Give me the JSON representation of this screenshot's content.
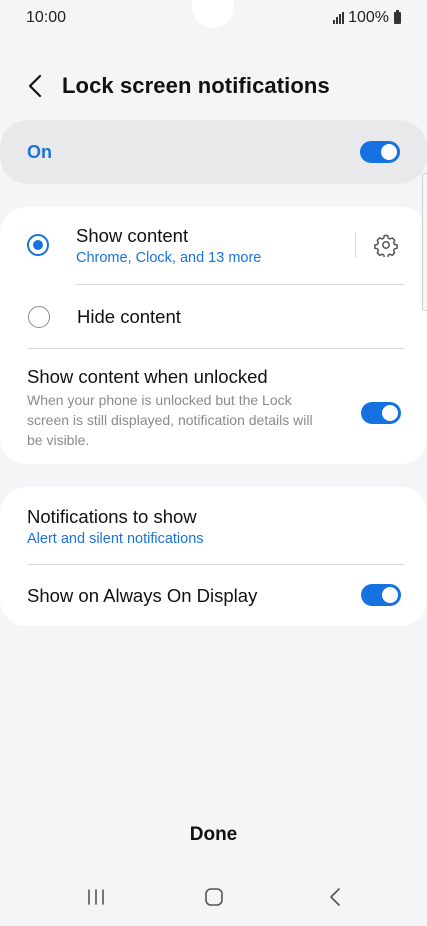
{
  "status_bar": {
    "time": "10:00",
    "battery": "100%"
  },
  "header": {
    "title": "Lock screen notifications"
  },
  "master_switch": {
    "label": "On",
    "enabled": true
  },
  "content_options": {
    "show_content": {
      "label": "Show content",
      "sublabel": "Chrome, Clock, and 13 more",
      "selected": true
    },
    "hide_content": {
      "label": "Hide content",
      "selected": false
    }
  },
  "show_when_unlocked": {
    "label": "Show content when unlocked",
    "description_lines": [
      "When your phone is unlocked but the Lock",
      "screen is still displayed, notification details will",
      "be visible."
    ],
    "enabled": true
  },
  "notifications_to_show": {
    "label": "Notifications to show",
    "value": "Alert and silent notifications"
  },
  "always_on_display": {
    "label": "Show on Always On Display",
    "enabled": true
  },
  "done_label": "Done",
  "nav": {
    "recents_icon": "recents-icon",
    "home_icon": "home-icon",
    "back_icon": "back-icon"
  },
  "colors": {
    "accent": "#1672e0",
    "background": "#f5f5f7",
    "card": "#ffffff",
    "master_row": "#e9e9ec"
  }
}
